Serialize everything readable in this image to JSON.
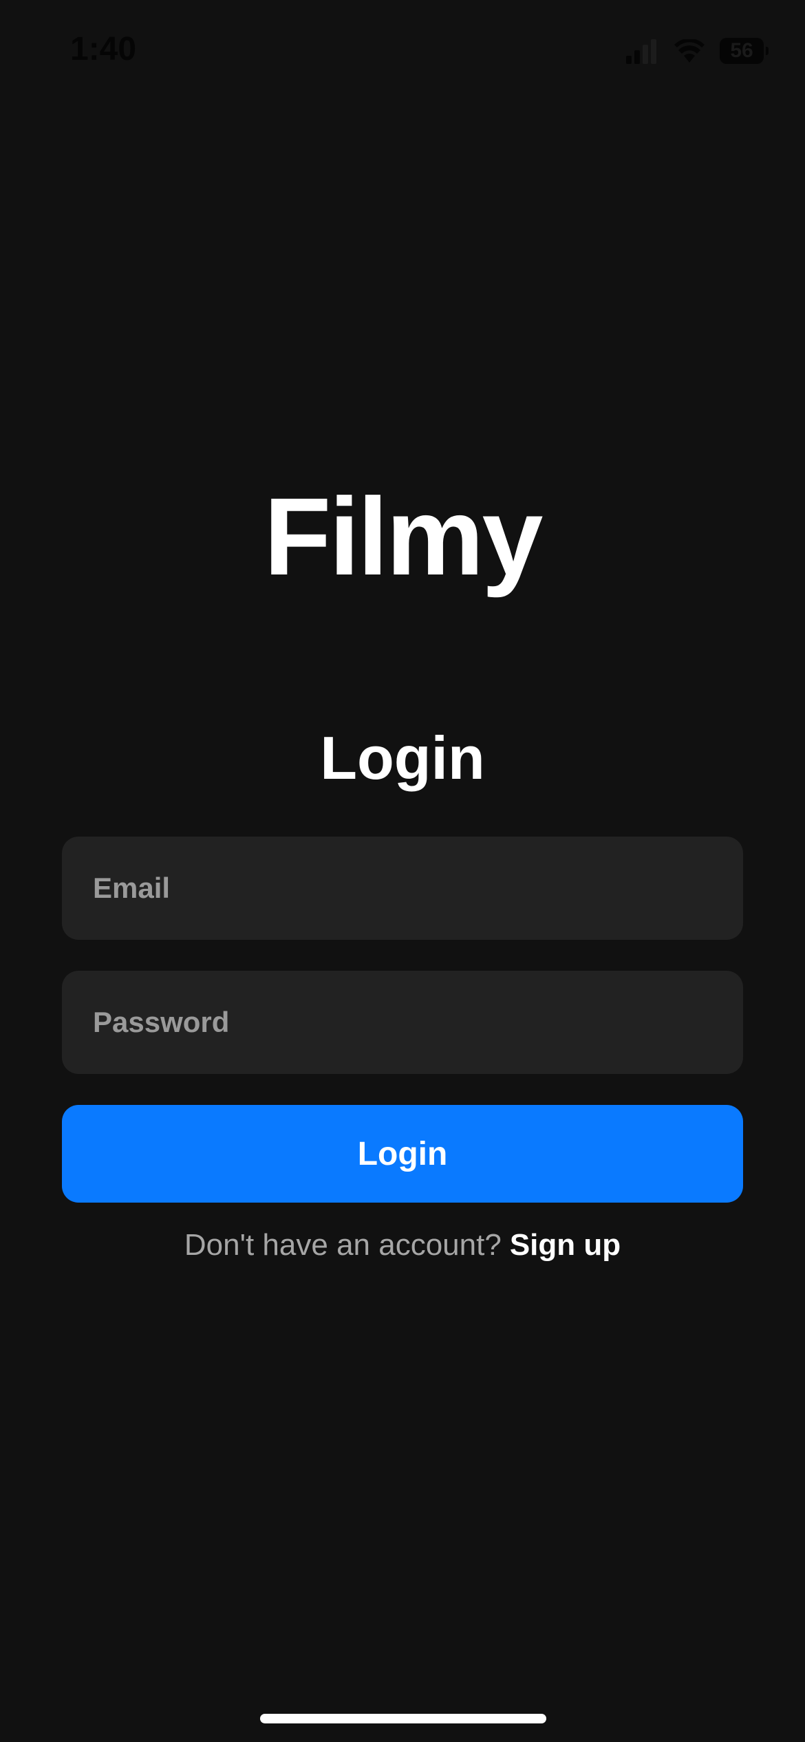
{
  "status_bar": {
    "time": "1:40",
    "battery_level": "56",
    "icons": [
      "signal-icon",
      "wifi-icon",
      "battery-icon"
    ]
  },
  "app": {
    "name": "Filmy"
  },
  "login_form": {
    "title": "Login",
    "email_placeholder": "Email",
    "password_placeholder": "Password",
    "submit_label": "Login",
    "signup_prompt": "Don't have an account?",
    "signup_link": "Sign up"
  },
  "colors": {
    "background": "#111111",
    "input_background": "#222222",
    "accent": "#0a7aff",
    "placeholder": "#9a9a9a",
    "secondary_text": "#a6a6a6"
  }
}
